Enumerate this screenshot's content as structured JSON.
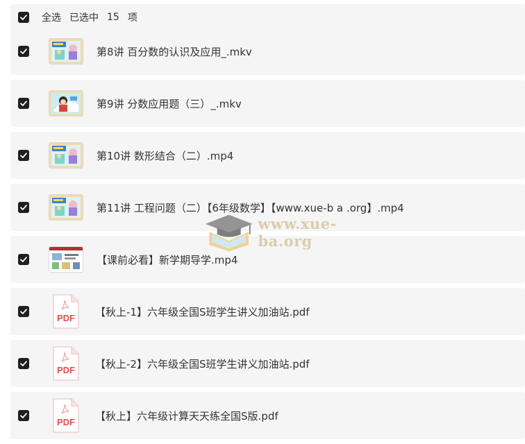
{
  "header": {
    "select_all_label": "全选",
    "selected_prefix": "已选中",
    "selected_count": "15",
    "selected_suffix": "项"
  },
  "files": [
    {
      "name": "第8讲 百分数的认识及应用_.mkv",
      "type": "video",
      "thumb": "cartoon-a"
    },
    {
      "name": "第9讲 分数应用题（三）_.mkv",
      "type": "video",
      "thumb": "cartoon-b"
    },
    {
      "name": "第10讲 数形结合（二）.mp4",
      "type": "video",
      "thumb": "cartoon-a"
    },
    {
      "name": "第11讲 工程问题（二）【6年级数学】【www.xue-b a .org】.mp4",
      "type": "video",
      "thumb": "cartoon-a"
    },
    {
      "name": "【课前必看】新学期导学.mp4",
      "type": "video",
      "thumb": "slide"
    },
    {
      "name": "【秋上-1】六年级全国S班学生讲义加油站.pdf",
      "type": "pdf"
    },
    {
      "name": "【秋上-2】六年级全国S班学生讲义加油站.pdf",
      "type": "pdf"
    },
    {
      "name": "【秋上】六年级计算天天练全国S版.pdf",
      "type": "pdf"
    }
  ],
  "pdf_icon_label": "PDF",
  "watermark": {
    "text": "www.xue-ba.org",
    "icon": "graduation-cap-icon"
  },
  "colors": {
    "row_bg": "#f5f5f6",
    "checkbox": "#1f1f1f",
    "pdf_red": "#e34d4d",
    "watermark": "#d9c8a3"
  }
}
